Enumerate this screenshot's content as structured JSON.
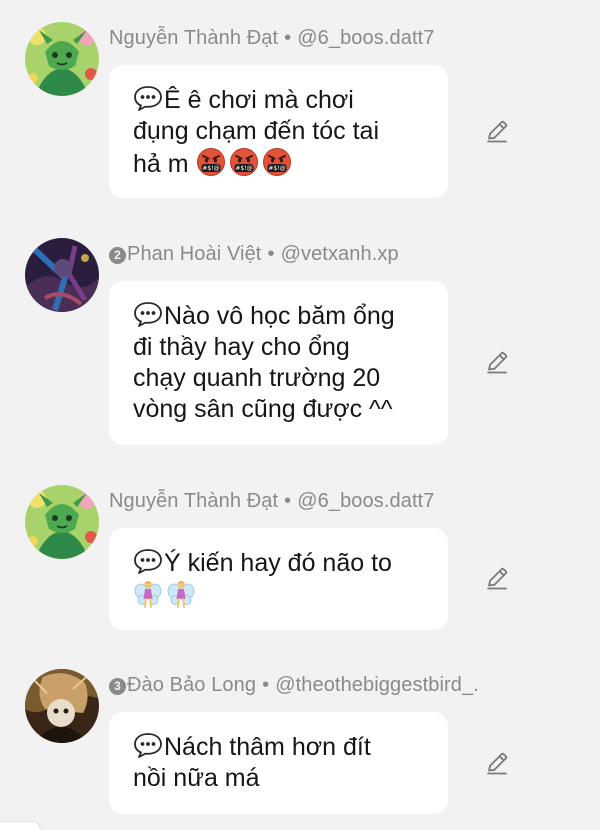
{
  "comments": [
    {
      "author": "Nguyễn Thành Đạt",
      "badge": "",
      "handle": "@6_boos.datt7",
      "lines": [
        "Ê ê chơi mà chơi",
        "đụng chạm đến tóc tai",
        "hả m"
      ],
      "emoji": "angry-cursing-face",
      "avatar_icon": "anime-avatar-green-icon"
    },
    {
      "author": "Phan Hoài Việt",
      "badge": "2",
      "handle": "@vetxanh.xp",
      "lines": [
        "Nào vô học băm ổng",
        "đi thầy hay cho ổng",
        "chạy quanh trường 20",
        "vòng sân cũng được ^^"
      ],
      "emoji": "",
      "avatar_icon": "dark-art-avatar-icon"
    },
    {
      "author": "Nguyễn Thành Đạt",
      "badge": "",
      "handle": "@6_boos.datt7",
      "lines": [
        "Ý kiến hay đó não to",
        ""
      ],
      "emoji": "fairy",
      "avatar_icon": "anime-avatar-green-icon"
    },
    {
      "author": "Đào Bảo Long",
      "badge": "3",
      "handle": "@theothebiggestbird_.",
      "lines": [
        "Nách thâm hơn đít",
        "nồi nữa má"
      ],
      "emoji": "",
      "avatar_icon": "sepia-art-avatar-icon"
    }
  ],
  "meta_separator": "•",
  "colors": {
    "background": "#f2f2f2",
    "bubble": "#ffffff",
    "meta_text": "#8a8a8a",
    "body_text": "#161616"
  }
}
